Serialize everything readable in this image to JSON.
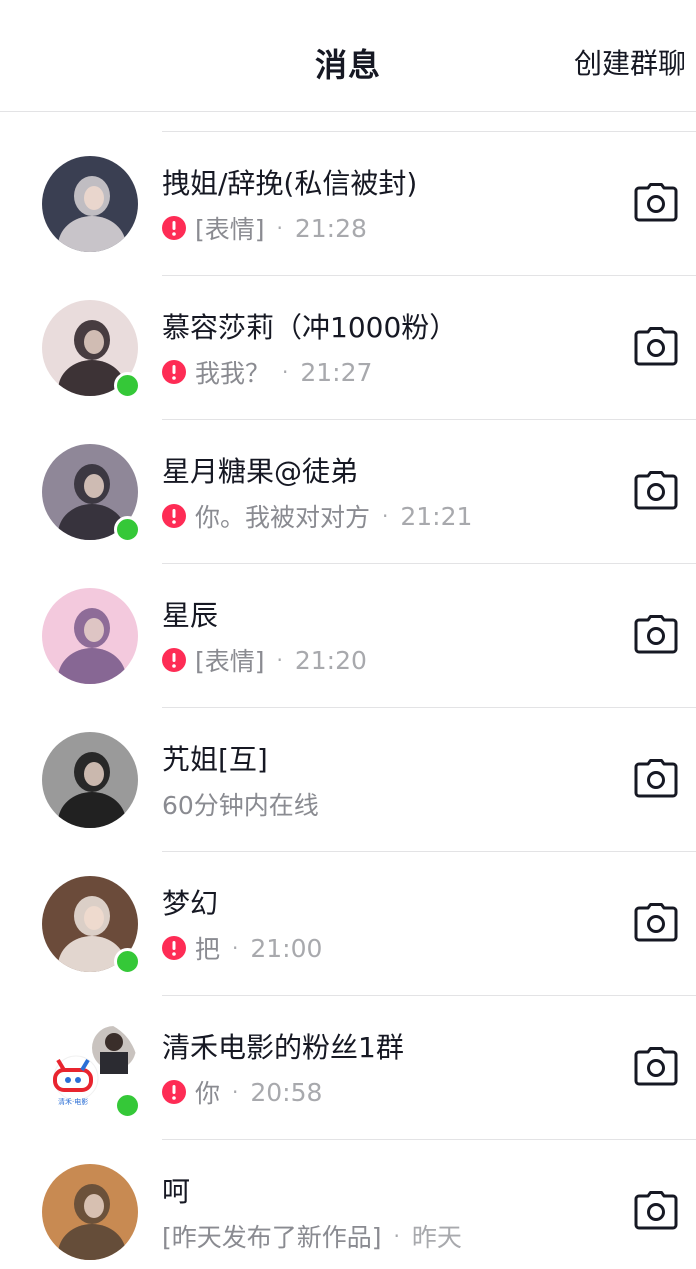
{
  "header": {
    "title": "消息",
    "create_group_label": "创建群聊"
  },
  "conversations": [
    {
      "name": "拽姐/辞挽(私信被封)",
      "status_icon": "alert-icon",
      "preview": "[表情]",
      "time": "21:28",
      "online": false,
      "avatar_colors": [
        "#3a3f52",
        "#d8d3d6"
      ]
    },
    {
      "name": "慕容莎莉（冲1000粉）",
      "status_icon": "alert-icon",
      "preview": "我我？",
      "time": "21:27",
      "online": true,
      "avatar_colors": [
        "#e9dcdc",
        "#2a2024"
      ]
    },
    {
      "name": "星月糖果@徒弟",
      "status_icon": "alert-icon",
      "preview": "你。我被对对方",
      "time": "21:21",
      "online": true,
      "avatar_colors": [
        "#8f8798",
        "#2e2a33"
      ]
    },
    {
      "name": "星辰",
      "status_icon": "alert-icon",
      "preview": "[表情]",
      "time": "21:20",
      "online": false,
      "avatar_colors": [
        "#f3c9dd",
        "#7b5c8c"
      ]
    },
    {
      "name": "艽姐[互]",
      "status_icon": "",
      "preview": "60分钟内在线",
      "time": "",
      "online": false,
      "avatar_colors": [
        "#9a9a9a",
        "#141414"
      ]
    },
    {
      "name": "梦幻",
      "status_icon": "alert-icon",
      "preview": "把",
      "time": "21:00",
      "online": true,
      "avatar_colors": [
        "#6b4b3a",
        "#efe6e0"
      ]
    },
    {
      "name": "清禾电影的粉丝1群",
      "status_icon": "alert-icon",
      "preview": "你",
      "time": "20:58",
      "online": true,
      "avatar_colors": [
        "#ffffff",
        "#e8242f"
      ]
    },
    {
      "name": "呵",
      "status_icon": "",
      "preview": "[昨天发布了新作品]",
      "time": "昨天",
      "online": false,
      "avatar_colors": [
        "#c88a52",
        "#5a4636"
      ]
    }
  ],
  "colors": {
    "online": "#35c838",
    "alert": "#fe2c55",
    "divider": "#e3e3e5",
    "secondary_text": "#8a8b91"
  },
  "icons": {
    "row_action": "camera-icon"
  }
}
